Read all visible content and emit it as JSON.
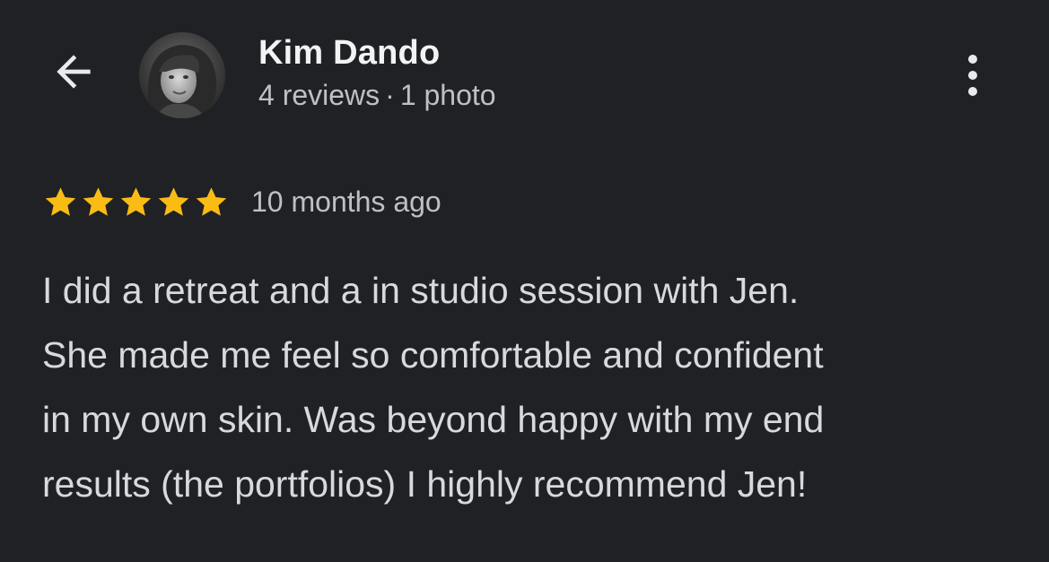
{
  "header": {
    "back_icon": "arrow-left-icon",
    "avatar_icon": "profile-photo",
    "name": "Kim Dando",
    "reviews": "4 reviews",
    "separator": "·",
    "photos": "1 photo",
    "more_icon": "more-vertical-icon"
  },
  "review": {
    "rating": 5,
    "rating_max": 5,
    "star_color": "#f9bc15",
    "date": "10 months ago",
    "lines": [
      "I did a retreat and a in studio session with Jen.",
      "She made me feel so comfortable and confident",
      "in my own skin. Was beyond happy with my end",
      "results (the portfolios) I highly recommend Jen!"
    ]
  }
}
